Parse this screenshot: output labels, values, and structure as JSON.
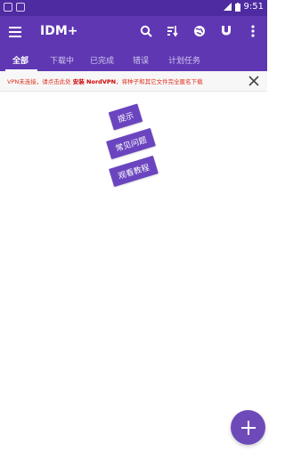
{
  "status_bar": {
    "time": "9:51"
  },
  "app_bar": {
    "title": "IDM+",
    "icons": [
      "menu-icon",
      "search-icon",
      "sort-icon",
      "globe-icon",
      "magnet-icon",
      "more-vert-icon"
    ]
  },
  "tabs": [
    {
      "label": "全部",
      "active": true
    },
    {
      "label": "下载中"
    },
    {
      "label": "已完成"
    },
    {
      "label": "错误"
    },
    {
      "label": "计划任务"
    }
  ],
  "vpn_banner": {
    "prefix": "VPN未连接，请点击此处 ",
    "strong": "安装 NordVPN",
    "suffix": "，将种子和其它文件完全匿名下载"
  },
  "stickers": [
    "提示",
    "常见问题",
    "观看教程"
  ],
  "colors": {
    "primary": "#5f37b3",
    "status_bar": "#4e2ba0",
    "accent": "#6e4ab9",
    "banner_text": "#e0301e"
  }
}
